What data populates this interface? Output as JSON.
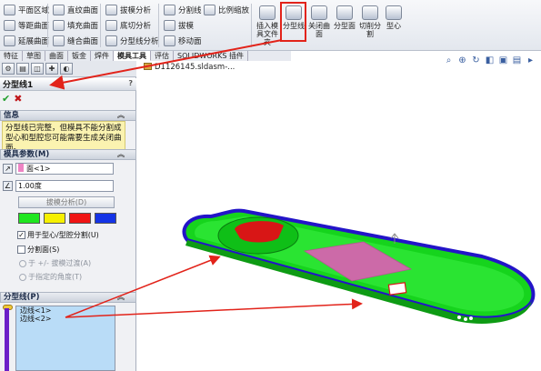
{
  "ribbon": {
    "col1": [
      "平面区域",
      "等距曲面",
      "延展曲面"
    ],
    "col2": [
      "直纹曲面",
      "填充曲面",
      "缝合曲面"
    ],
    "col3": [
      "拔模分析",
      "底切分析",
      "分型线分析"
    ],
    "col4": [
      "分割线",
      "拔模",
      "移动面"
    ],
    "col5": [
      "比例缩放"
    ],
    "big_buttons": [
      "插入模具文件夹",
      "分型线",
      "关闭曲面",
      "分型面",
      "切削分割",
      "型心"
    ]
  },
  "tabs": [
    "特征",
    "草图",
    "曲面",
    "钣金",
    "焊件",
    "模具工具",
    "评估",
    "SOLIDWORKS 插件"
  ],
  "active_tab_index": 5,
  "document": {
    "title": "D1126145.sldasm-..."
  },
  "view_tools": [
    "search-icon",
    "zoom-icon",
    "rotate-icon",
    "section-icon",
    "display-icon",
    "view-cube-icon",
    "more-icon"
  ],
  "pm": {
    "title": "分型线1",
    "help": "?",
    "ok": "✔",
    "cancel": "✖",
    "info": {
      "header": "信息",
      "text": "分型线已完整，但模具不能分割成型心和型腔您可能需要生成关闭曲面。"
    },
    "mold_params": {
      "header": "模具参数(M)",
      "face_field": "面<1>",
      "angle_field": "1.00度",
      "draft_button": "拔模分析(D)",
      "swatch_colors": [
        "#1fe61f",
        "#f6f000",
        "#f01414",
        "#1433e6"
      ],
      "cb_core_cavity": "用于型心/型腔分割(U)",
      "cb_split_faces": "分割面(S)",
      "radio_transition": "于 +/- 拔模过渡(A)",
      "radio_angle": "于指定的角度(T)"
    },
    "parting_line": {
      "header": "分型线(P)",
      "edges": [
        "边线<1>",
        "边线<2>"
      ]
    }
  },
  "colors": {
    "part_green": "#16d41d",
    "edge_blue": "#2314c8",
    "cavity_red": "#d81616",
    "face_pink": "#cc6aa8",
    "highlight_red": "#e2231a"
  }
}
